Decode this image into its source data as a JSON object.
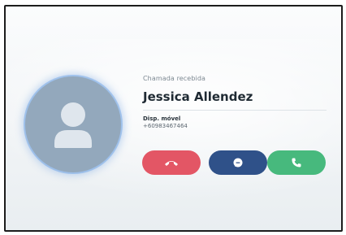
{
  "call": {
    "status_label": "Chamada recebida",
    "caller_name": "Jessica Allendez",
    "phone_type": "Disp. móvel",
    "phone_number": "+60983467464"
  },
  "actions": {
    "decline_icon": "hang-up-icon",
    "message_icon": "message-icon",
    "accept_icon": "phone-icon"
  },
  "colors": {
    "decline": "#e35665",
    "message": "#2f5189",
    "accept": "#47b97d",
    "avatar": "#93a8bc"
  }
}
